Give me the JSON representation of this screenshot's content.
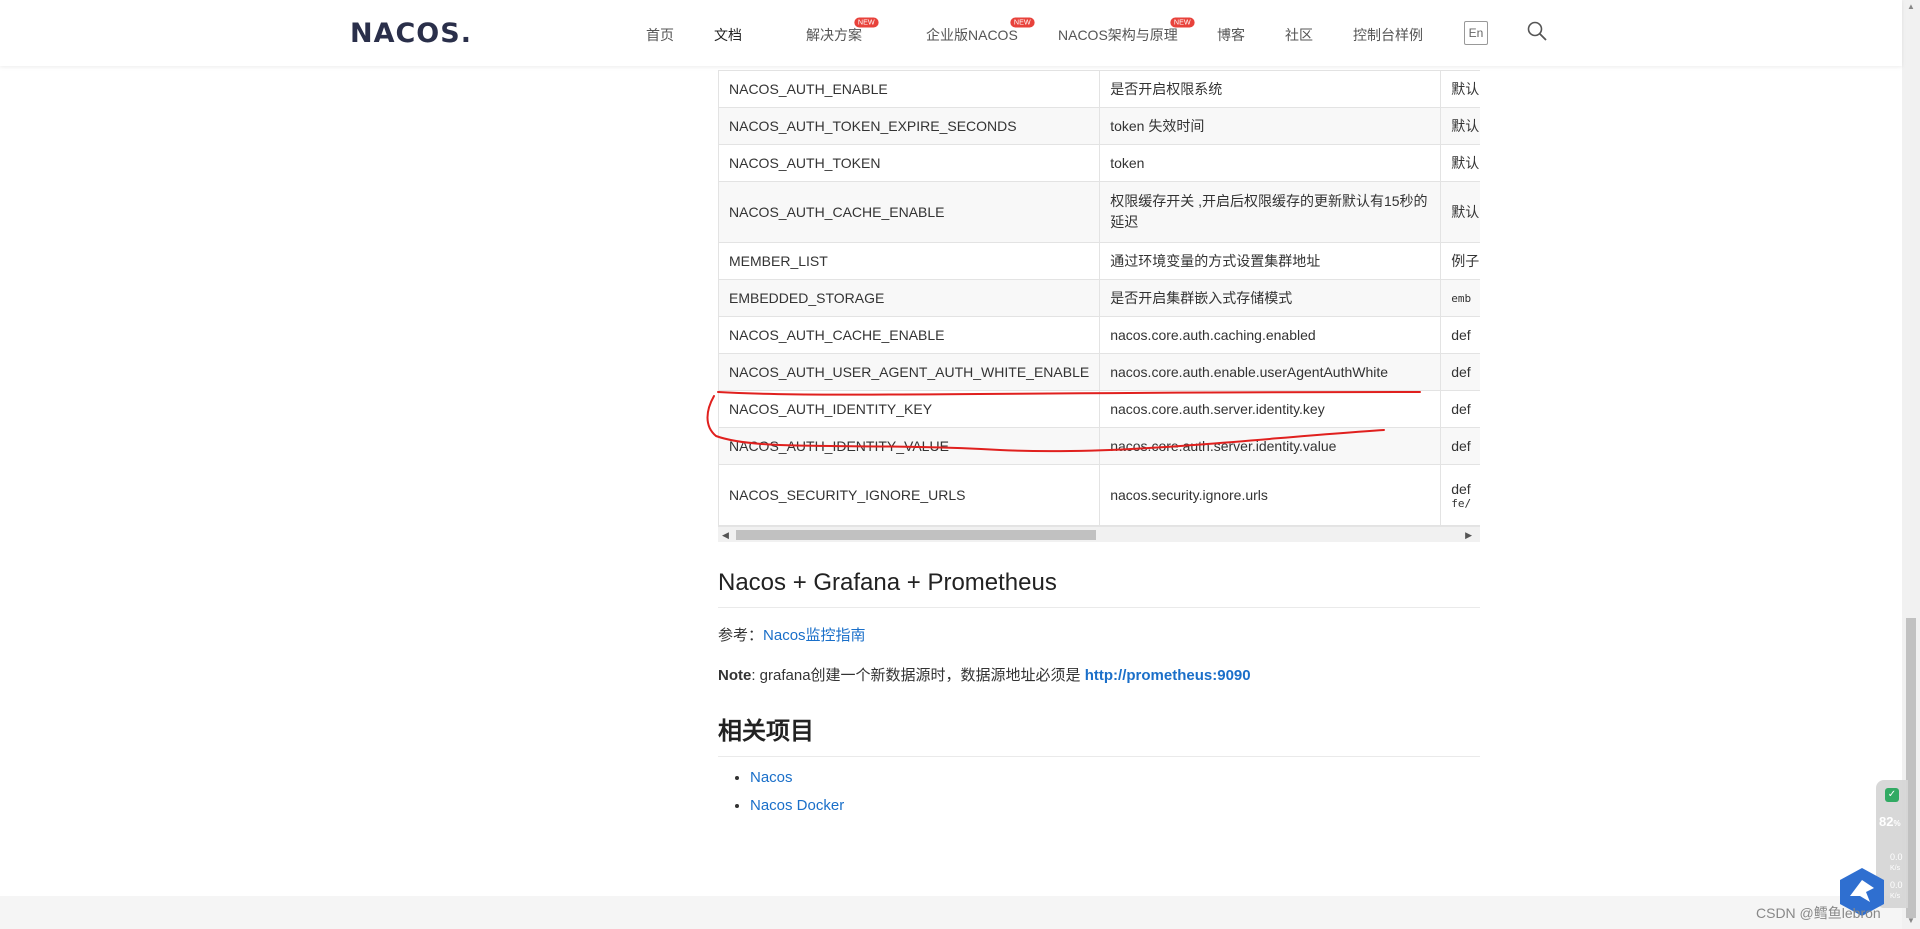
{
  "header": {
    "logo_text": "NACOS.",
    "nav": [
      {
        "label": "首页",
        "new": false
      },
      {
        "label": "文档",
        "new": false,
        "active": true
      },
      {
        "label": "解决方案",
        "new": true
      },
      {
        "label": "企业版NACOS",
        "new": true
      },
      {
        "label": "NACOS架构与原理",
        "new": true
      },
      {
        "label": "博客",
        "new": false
      },
      {
        "label": "社区",
        "new": false
      },
      {
        "label": "控制台样例",
        "new": false
      }
    ],
    "new_badge": "NEW",
    "lang_button": "En"
  },
  "table": {
    "rows": [
      {
        "name": "NACOS_AUTH_ENABLE",
        "desc": "是否开启权限系统",
        "extra": "默认"
      },
      {
        "name": "NACOS_AUTH_TOKEN_EXPIRE_SECONDS",
        "desc": "token 失效时间",
        "extra": "默认"
      },
      {
        "name": "NACOS_AUTH_TOKEN",
        "desc": "token",
        "extra": "默认"
      },
      {
        "name": "NACOS_AUTH_CACHE_ENABLE",
        "desc": "权限缓存开关 ,开启后权限缓存的更新默认有15秒的延迟",
        "extra": "默认"
      },
      {
        "name": "MEMBER_LIST",
        "desc": "通过环境变量的方式设置集群地址",
        "extra": "例子"
      },
      {
        "name": "EMBEDDED_STORAGE",
        "desc": "是否开启集群嵌入式存储模式",
        "extra": "emb"
      },
      {
        "name": "NACOS_AUTH_CACHE_ENABLE",
        "desc": "nacos.core.auth.caching.enabled",
        "extra": "def"
      },
      {
        "name": "NACOS_AUTH_USER_AGENT_AUTH_WHITE_ENABLE",
        "desc": "nacos.core.auth.enable.userAgentAuthWhite",
        "extra": "def"
      },
      {
        "name": "NACOS_AUTH_IDENTITY_KEY",
        "desc": "nacos.core.auth.server.identity.key",
        "extra": "def"
      },
      {
        "name": "NACOS_AUTH_IDENTITY_VALUE",
        "desc": "nacos.core.auth.server.identity.value",
        "extra": "def"
      },
      {
        "name": "NACOS_SECURITY_IGNORE_URLS",
        "desc": "nacos.security.ignore.urls",
        "extra": "def",
        "extra2": "fe/"
      }
    ]
  },
  "section1": {
    "title": "Nacos + Grafana + Prometheus",
    "ref_label": "参考：",
    "ref_link": "Nacos监控指南",
    "note_label": "Note",
    "note_text": ": grafana创建一个新数据源时，数据源地址必须是 ",
    "note_link": "http://prometheus:9090"
  },
  "section2": {
    "title": "相关项目",
    "items": [
      "Nacos",
      "Nacos Docker"
    ]
  },
  "widget": {
    "percent": "82",
    "percent_unit": "%",
    "speed1": "0.0",
    "speed1_unit": "K/s",
    "speed2": "0.0",
    "speed2_unit": "K/s"
  },
  "watermark": "CSDN @鳕鱼lebron",
  "colors": {
    "link": "#1a6fc9",
    "annotation": "#e0201e",
    "badge": "#e8423b"
  }
}
